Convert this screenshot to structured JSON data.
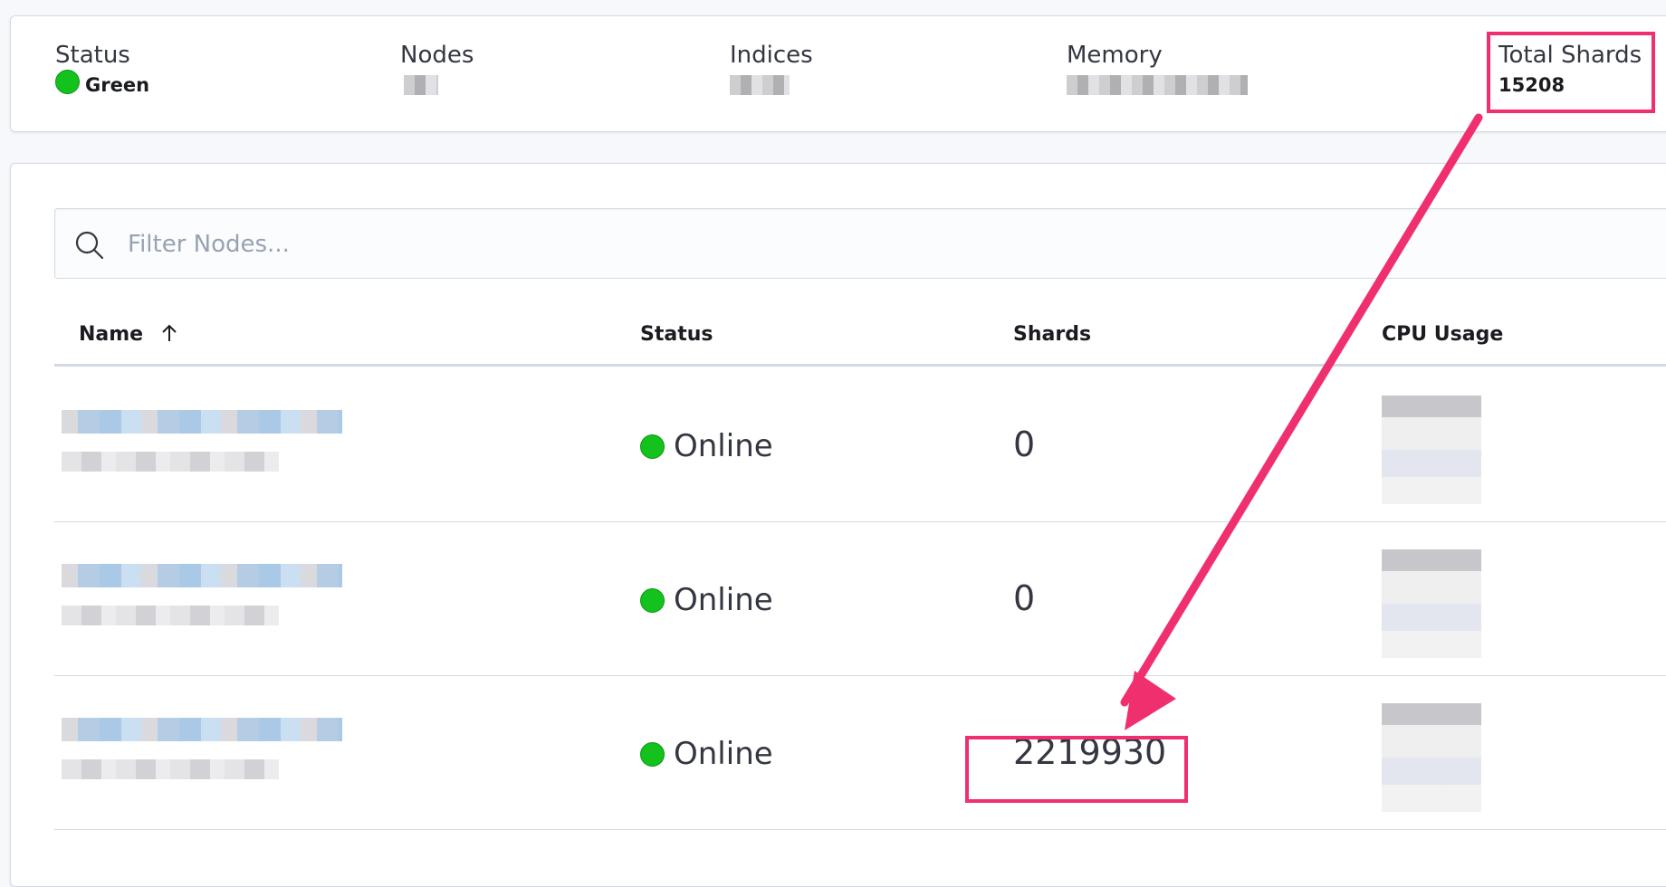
{
  "summary": {
    "status": {
      "label": "Status",
      "value": "Green"
    },
    "nodes": {
      "label": "Nodes"
    },
    "indices": {
      "label": "Indices"
    },
    "memory": {
      "label": "Memory"
    },
    "total_shards": {
      "label": "Total Shards",
      "value": "15208"
    }
  },
  "search": {
    "placeholder": "Filter Nodes..."
  },
  "table": {
    "columns": {
      "name": "Name",
      "status": "Status",
      "shards": "Shards",
      "cpu": "CPU Usage"
    },
    "rows": [
      {
        "status": "Online",
        "shards": "0"
      },
      {
        "status": "Online",
        "shards": "0"
      },
      {
        "status": "Online",
        "shards": "2219930"
      }
    ]
  },
  "colors": {
    "status_green": "#13c21c",
    "annotation": "#f0306e"
  }
}
